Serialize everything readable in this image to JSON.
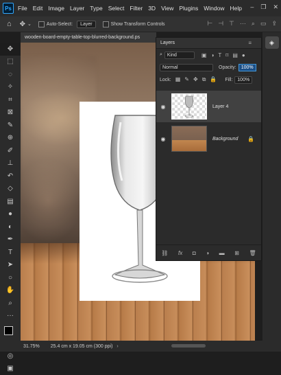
{
  "app": {
    "logo": "Ps"
  },
  "menu": [
    "File",
    "Edit",
    "Image",
    "Layer",
    "Type",
    "Select",
    "Filter",
    "3D",
    "View",
    "Plugins",
    "Window",
    "Help"
  ],
  "window_controls": [
    "–",
    "❐",
    "✕"
  ],
  "options": {
    "auto_select_label": "Auto-Select:",
    "auto_select_value": "Layer",
    "transform_controls_label": "Show Transform Controls"
  },
  "document": {
    "tab_title": "wooden-board-empty-table-top-blurred-background.ps"
  },
  "layers_panel": {
    "title": "Layers",
    "filter_kind": "Kind",
    "blend_mode": "Normal",
    "opacity_label": "Opacity:",
    "opacity_value": "100%",
    "lock_label": "Lock:",
    "fill_label": "Fill:",
    "fill_value": "100%",
    "layers": [
      {
        "name": "Layer 4",
        "visible": true,
        "selected": true
      },
      {
        "name": "Background",
        "visible": true,
        "selected": false,
        "locked": true
      }
    ],
    "footer_icons": [
      "link-icon",
      "fx-icon",
      "mask-icon",
      "adjustment-icon",
      "folder-icon",
      "new-layer-icon",
      "trash-icon"
    ],
    "footer_fx": "fx"
  },
  "status": {
    "zoom": "31.75%",
    "doc_info": "25.4 cm x 19.05 cm (300 ppi)",
    "arrow": "›"
  },
  "colors": {
    "accent": "#31a8ff",
    "panel": "#2b2b2b",
    "selected_layer": "#414141"
  }
}
